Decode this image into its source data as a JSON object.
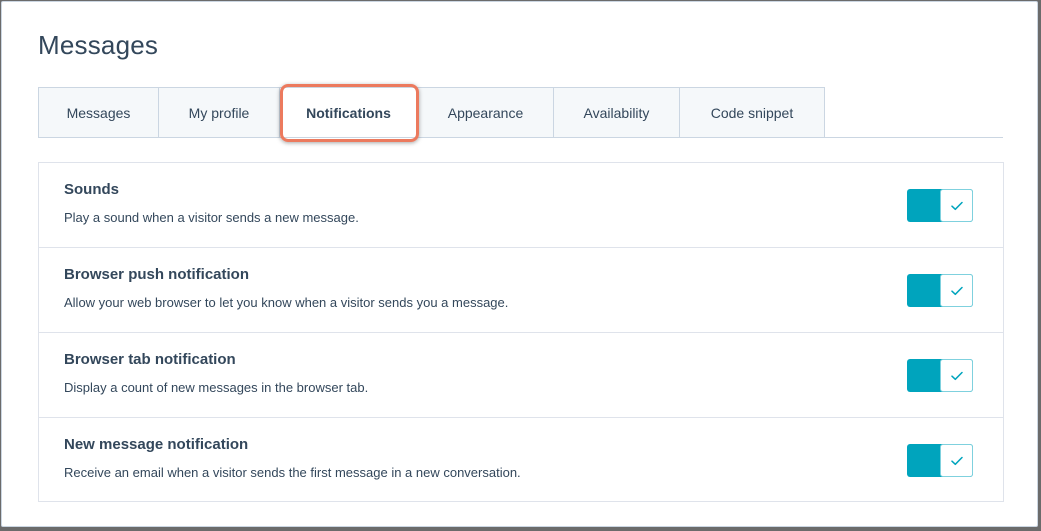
{
  "page": {
    "title": "Messages"
  },
  "tabs": [
    {
      "label": "Messages"
    },
    {
      "label": "My profile"
    },
    {
      "label": "Notifications"
    },
    {
      "label": "Appearance"
    },
    {
      "label": "Availability"
    },
    {
      "label": "Code snippet"
    }
  ],
  "active_tab": "Notifications",
  "colors": {
    "accent": "#00a4bd",
    "highlight": "#ec7a5e",
    "text": "#33475b"
  },
  "settings": [
    {
      "title": "Sounds",
      "description": "Play a sound when a visitor sends a new message.",
      "enabled": true
    },
    {
      "title": "Browser push notification",
      "description": "Allow your web browser to let you know when a visitor sends you a message.",
      "enabled": true
    },
    {
      "title": "Browser tab notification",
      "description": "Display a count of new messages in the browser tab.",
      "enabled": true
    },
    {
      "title": "New message notification",
      "description": "Receive an email when a visitor sends the first message in a new conversation.",
      "enabled": true
    }
  ]
}
